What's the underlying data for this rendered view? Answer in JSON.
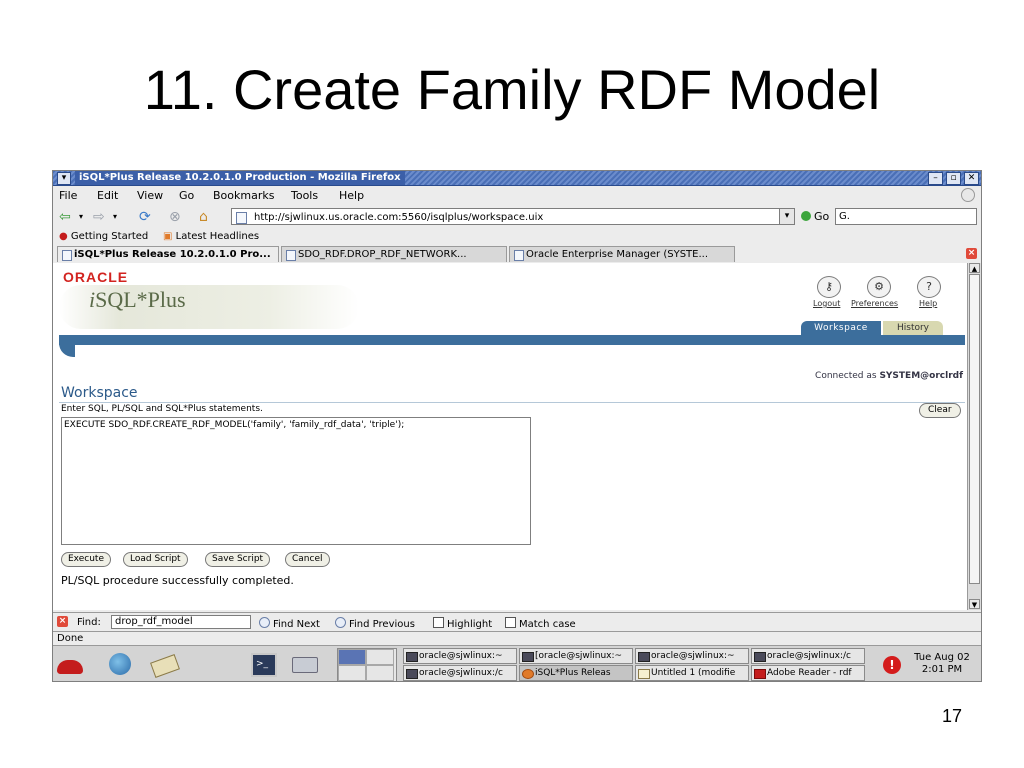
{
  "slide": {
    "title": "11. Create Family RDF Model",
    "number": "17"
  },
  "window": {
    "title": "iSQL*Plus Release 10.2.0.1.0 Production - Mozilla Firefox",
    "menu_glyph": "▾",
    "min": "–",
    "max": "▫",
    "close": "✕"
  },
  "menu": {
    "file": "File",
    "edit": "Edit",
    "view": "View",
    "go": "Go",
    "bookmarks": "Bookmarks",
    "tools": "Tools",
    "help": "Help"
  },
  "nav": {
    "url": "http://sjwlinux.us.oracle.com:5560/isqlplus/workspace.uix",
    "go_label": "Go",
    "search_value": "G."
  },
  "bookmarks": {
    "getting_started": "Getting Started",
    "latest_headlines": "Latest Headlines"
  },
  "tabs": [
    {
      "label": "iSQL*Plus Release 10.2.0.1.0 Pro..."
    },
    {
      "label": "SDO_RDF.DROP_RDF_NETWORK..."
    },
    {
      "label": "Oracle Enterprise Manager (SYSTE..."
    }
  ],
  "app": {
    "brand": "ORACLE",
    "product_prefix": "i",
    "product": "SQL*Plus",
    "header_links": {
      "logout": "Logout",
      "preferences": "Preferences",
      "help": "Help"
    },
    "header_tabs": {
      "workspace": "Workspace",
      "history": "History"
    },
    "connected_prefix": "Connected as ",
    "connected_user": "SYSTEM@orclrdf",
    "workspace_heading": "Workspace",
    "instructions": "Enter SQL, PL/SQL and SQL*Plus statements.",
    "clear": "Clear",
    "sql": "EXECUTE SDO_RDF.CREATE_RDF_MODEL('family', 'family_rdf_data', 'triple');",
    "buttons": {
      "execute": "Execute",
      "load_script": "Load Script",
      "save_script": "Save Script",
      "cancel": "Cancel"
    },
    "result": "PL/SQL procedure successfully completed."
  },
  "find": {
    "label": "Find:",
    "value": "drop_rdf_model",
    "next": "Find Next",
    "previous": "Find Previous",
    "highlight": "Highlight",
    "match_case": "Match case"
  },
  "status": "Done",
  "taskbar": {
    "tasks": [
      {
        "label": "oracle@sjwlinux:~"
      },
      {
        "label": "[oracle@sjwlinux:~"
      },
      {
        "label": "oracle@sjwlinux:~"
      },
      {
        "label": "oracle@sjwlinux:/c"
      },
      {
        "label": "oracle@sjwlinux:/c"
      },
      {
        "label": "iSQL*Plus Releas"
      },
      {
        "label": "Untitled 1 (modifie"
      },
      {
        "label": "Adobe Reader - rdf"
      }
    ],
    "clock_day": "Tue Aug 02",
    "clock_time": "2:01 PM"
  },
  "colors": {
    "oracle_red": "#d2231f",
    "nav_blue": "#3c6e9c",
    "heading_blue": "#2c5a8a"
  }
}
